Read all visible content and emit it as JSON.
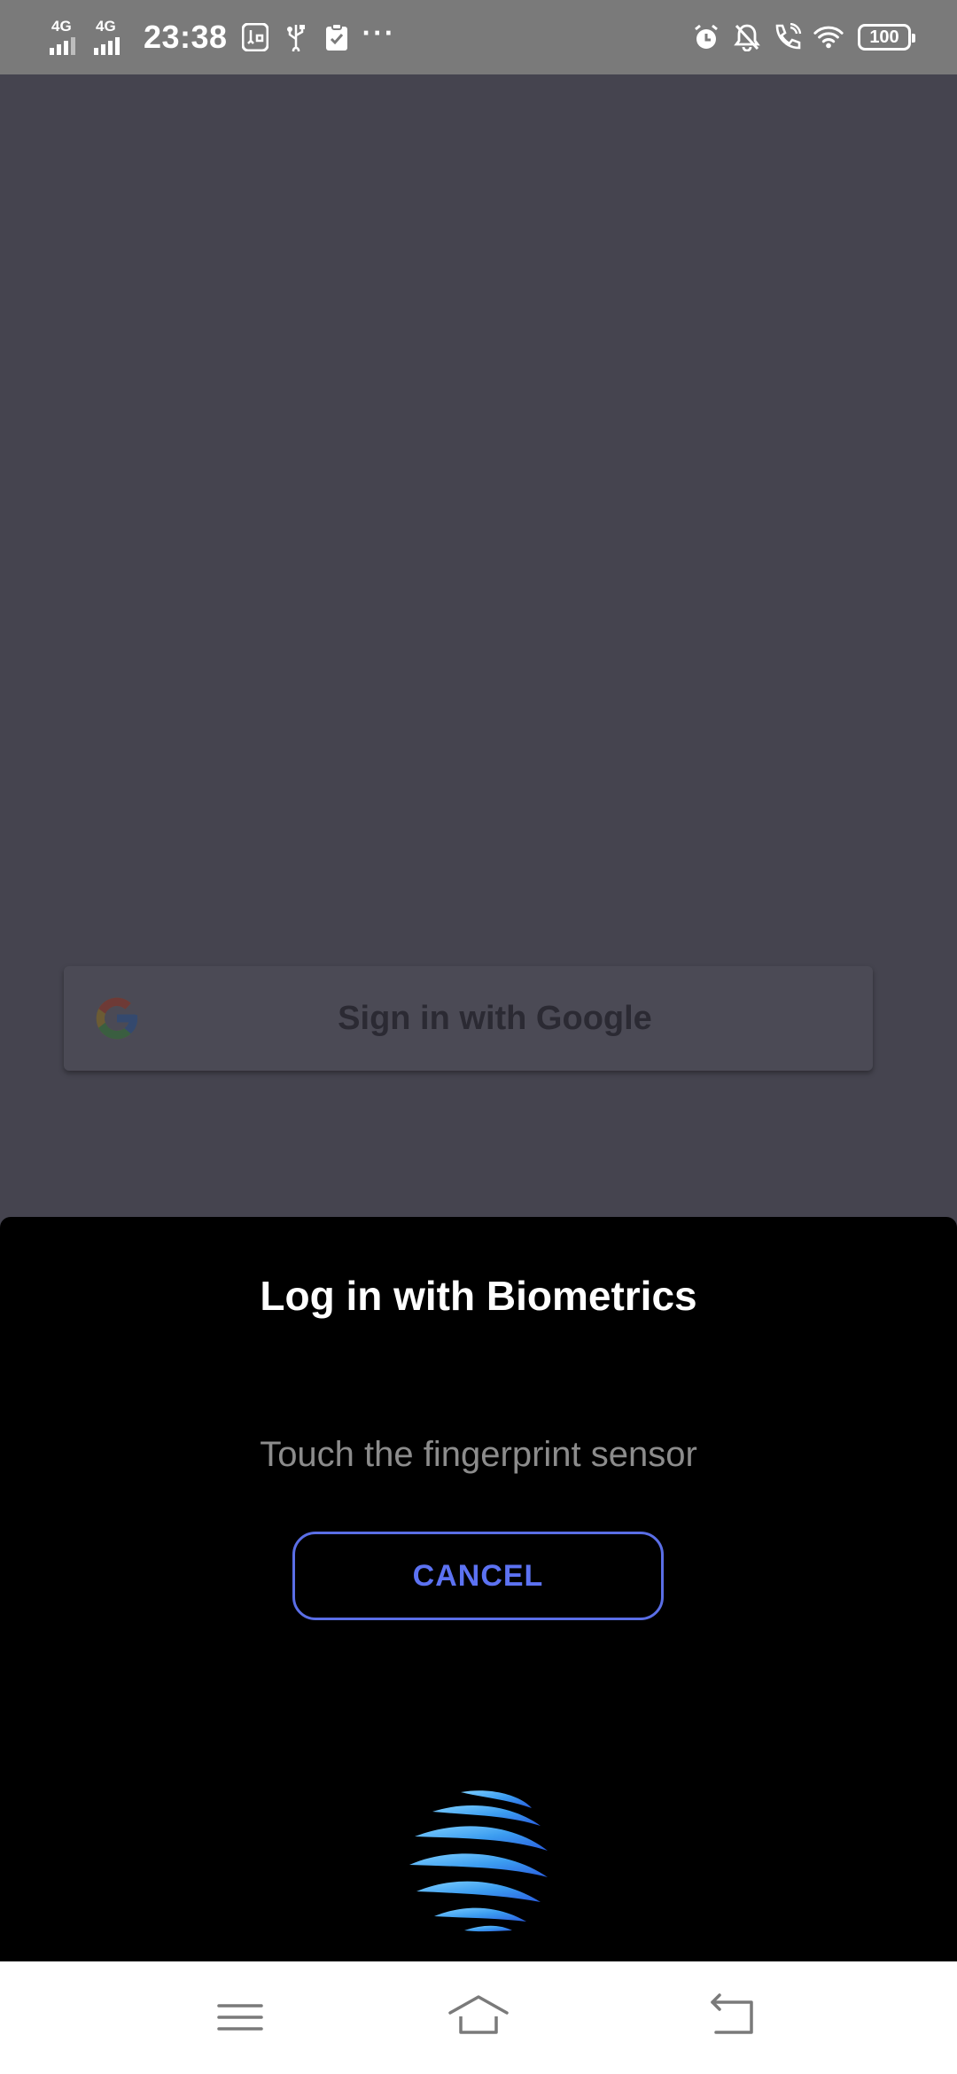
{
  "status_bar": {
    "network_1": "4G",
    "network_2": "4G",
    "time": "23:38",
    "battery": "100",
    "overflow": "···",
    "icons": [
      "usb-debug-icon",
      "usb-icon",
      "clipboard-check-icon",
      "alarm-icon",
      "notifications-off-icon",
      "volte-call-icon",
      "wifi-icon"
    ]
  },
  "google_signin": {
    "label": "Sign in with Google",
    "logo": "google-g-logo"
  },
  "biometric_sheet": {
    "title": "Log in with Biometrics",
    "subtitle": "Touch the fingerprint sensor",
    "cancel_label": "CANCEL",
    "sensor_icon": "fingerprint-sensor-icon",
    "accent_color": "#5c72f2"
  },
  "nav_bar": {
    "items": [
      "menu-icon",
      "home-icon",
      "back-icon"
    ]
  }
}
